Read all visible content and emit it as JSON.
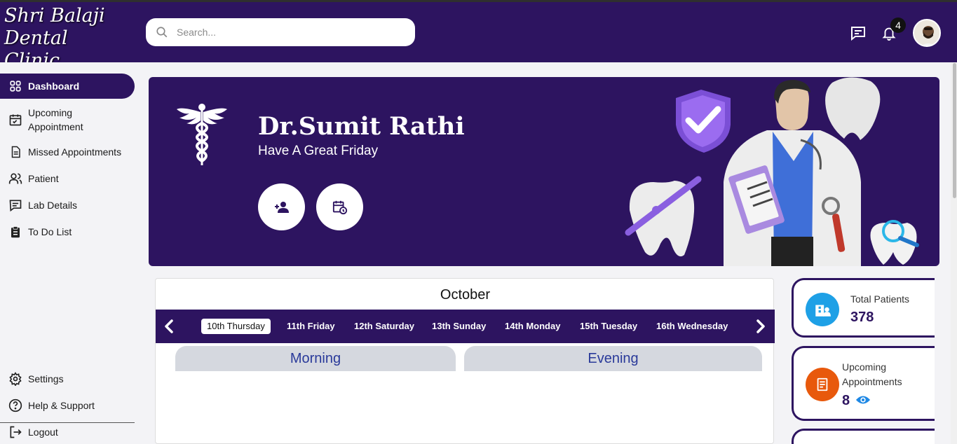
{
  "app": {
    "logo_line1": "Shri Balaji",
    "logo_line2": "Dental Clinic"
  },
  "header": {
    "search_placeholder": "Search...",
    "notification_count": "4"
  },
  "sidebar": {
    "items": [
      {
        "label": "Dashboard"
      },
      {
        "label": "Upcoming Appointment"
      },
      {
        "label": "Missed Appointments"
      },
      {
        "label": "Patient"
      },
      {
        "label": "Lab Details"
      },
      {
        "label": "To Do List"
      }
    ],
    "bottom": [
      {
        "label": "Settings"
      },
      {
        "label": "Help & Support"
      },
      {
        "label": "Logout"
      }
    ]
  },
  "banner": {
    "doctor_name": "Dr.Sumit Rathi",
    "greeting": "Have A Great Friday"
  },
  "calendar": {
    "month": "October",
    "days": [
      "10th Thursday",
      "11th Friday",
      "12th Saturday",
      "13th Sunday",
      "14th Monday",
      "15th Tuesday",
      "16th Wednesday"
    ],
    "selected_day": "10th Thursday",
    "shifts": {
      "morning": "Morning",
      "evening": "Evening"
    }
  },
  "stats": {
    "total_patients": {
      "label": "Total Patients",
      "value": "378"
    },
    "upcoming_appointments": {
      "label": "Upcoming Appointments",
      "value": "8"
    }
  },
  "colors": {
    "primary": "#2d1460",
    "accent_blue": "#1ea0e6",
    "accent_orange": "#e8590c",
    "shift_text": "#2a3a9a"
  },
  "icons": [
    "search-icon",
    "chat-icon",
    "bell-icon",
    "dashboard-icon",
    "calendar-check-icon",
    "document-icon",
    "users-icon",
    "message-icon",
    "clipboard-icon",
    "gear-icon",
    "help-icon",
    "logout-icon",
    "caduceus-icon",
    "add-user-icon",
    "calendar-clock-icon",
    "chevron-left-icon",
    "chevron-right-icon",
    "hospital-icon",
    "appointment-doc-icon",
    "eye-icon"
  ]
}
